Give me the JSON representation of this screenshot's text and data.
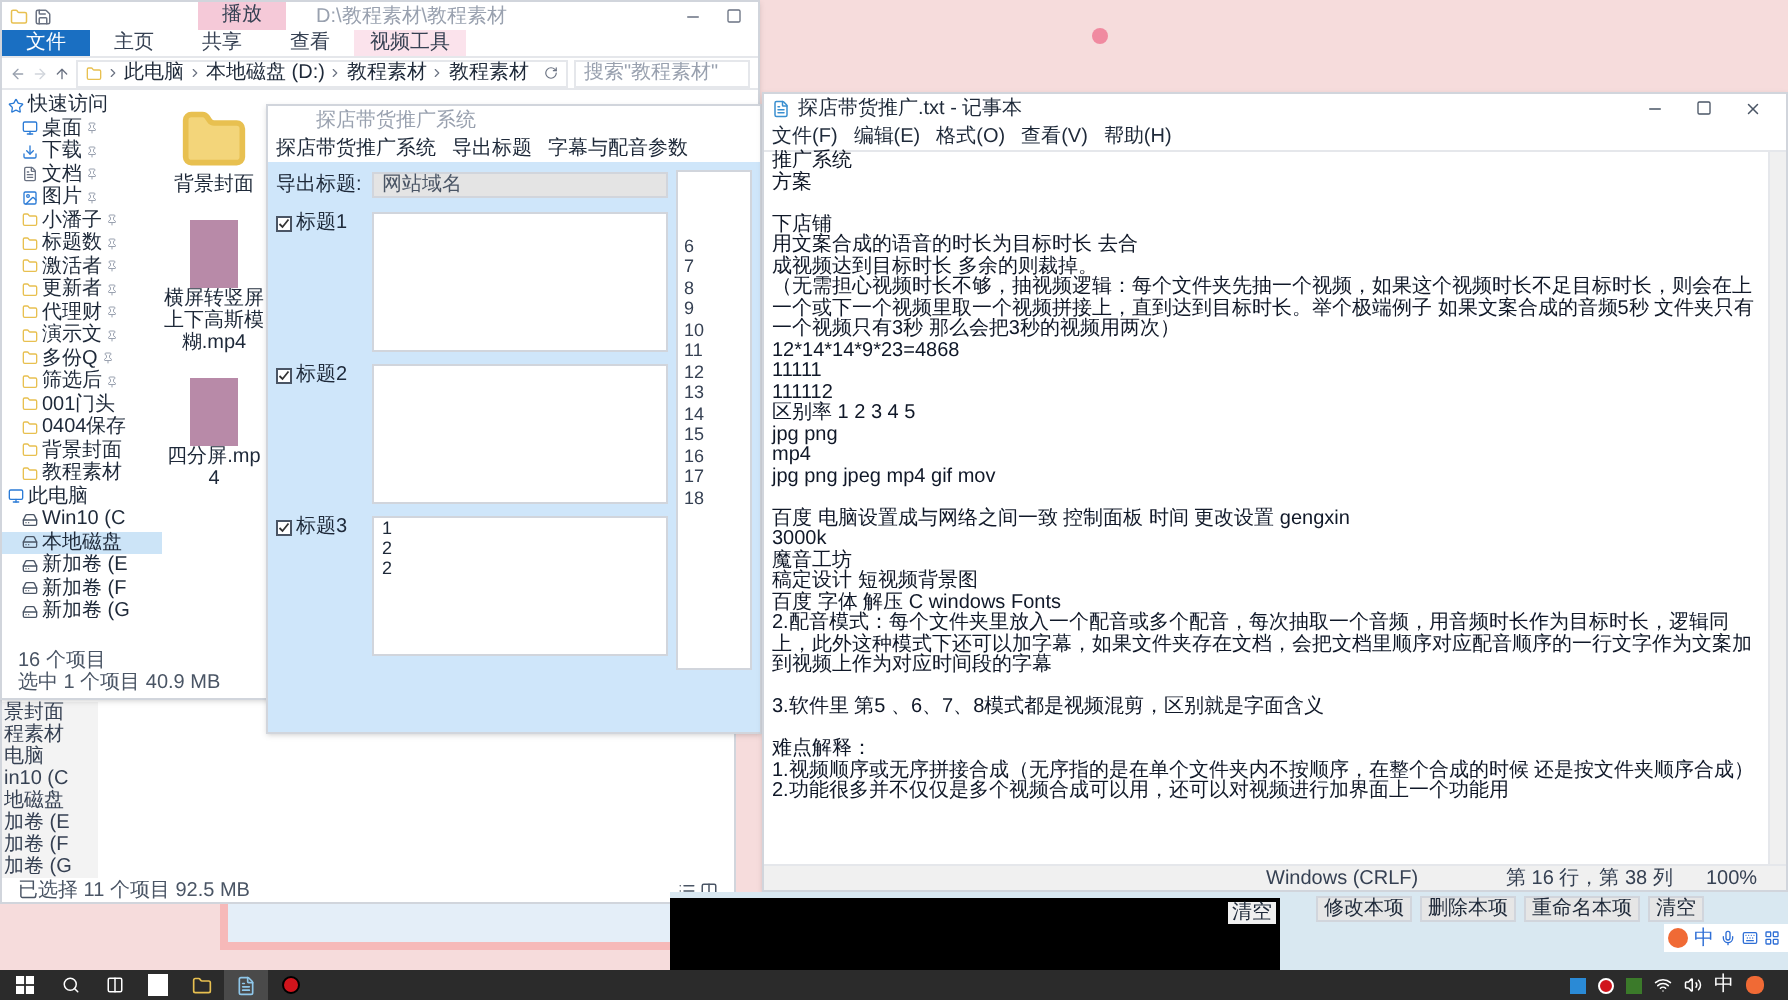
{
  "explorer_back": {
    "sidebar_items": [
      "景封面",
      "程素材",
      "电脑",
      "in10 (C",
      "地磁盘",
      "加卷 (E",
      "加卷 (F",
      "加卷 (G"
    ],
    "status": "已选择 11 个项目  92.5 MB"
  },
  "explorer": {
    "title": "D:\\教程素材\\教程素材",
    "context_tab": "播放",
    "ribbon_tabs": [
      {
        "label": "文件",
        "kind": "file"
      },
      {
        "label": "主页",
        "kind": "tab"
      },
      {
        "label": "共享",
        "kind": "tab"
      },
      {
        "label": "查看",
        "kind": "tab"
      },
      {
        "label": "视频工具",
        "kind": "context"
      }
    ],
    "breadcrumbs": [
      "此电脑",
      "本地磁盘 (D:)",
      "教程素材",
      "教程素材"
    ],
    "search": {
      "placeholder": "搜索\"教程素材\""
    },
    "sidebar": [
      {
        "label": "快速访问",
        "kind": "star",
        "pinned": false,
        "selected": false
      },
      {
        "label": "桌面",
        "kind": "desktop",
        "pinned": true,
        "selected": false
      },
      {
        "label": "下载",
        "kind": "download",
        "pinned": true,
        "selected": false
      },
      {
        "label": "文档",
        "kind": "document",
        "pinned": true,
        "selected": false
      },
      {
        "label": "图片",
        "kind": "picture",
        "pinned": true,
        "selected": false
      },
      {
        "label": "小潘子",
        "kind": "folder",
        "pinned": true,
        "selected": false
      },
      {
        "label": "标题数",
        "kind": "folder",
        "pinned": true,
        "selected": false
      },
      {
        "label": "激活者",
        "kind": "folder",
        "pinned": true,
        "selected": false
      },
      {
        "label": "更新者",
        "kind": "folder",
        "pinned": true,
        "selected": false
      },
      {
        "label": "代理财",
        "kind": "folder",
        "pinned": true,
        "selected": false
      },
      {
        "label": "演示文",
        "kind": "folder",
        "pinned": true,
        "selected": false
      },
      {
        "label": "多份Q",
        "kind": "folder",
        "pinned": true,
        "selected": false
      },
      {
        "label": "筛选后",
        "kind": "folder",
        "pinned": true,
        "selected": false
      },
      {
        "label": "001门头",
        "kind": "folder",
        "pinned": false,
        "selected": false
      },
      {
        "label": "0404保存",
        "kind": "folder",
        "pinned": false,
        "selected": false
      },
      {
        "label": "背景封面",
        "kind": "folder",
        "pinned": false,
        "selected": false
      },
      {
        "label": "教程素材",
        "kind": "folder",
        "pinned": false,
        "selected": false
      },
      {
        "label": "此电脑",
        "kind": "pc",
        "pinned": false,
        "selected": false
      },
      {
        "label": "Win10 (C",
        "kind": "drive",
        "pinned": false,
        "selected": false
      },
      {
        "label": "本地磁盘",
        "kind": "drive",
        "pinned": false,
        "selected": true
      },
      {
        "label": "新加卷 (E",
        "kind": "drive",
        "pinned": false,
        "selected": false
      },
      {
        "label": "新加卷 (F",
        "kind": "drive",
        "pinned": false,
        "selected": false
      },
      {
        "label": "新加卷 (G",
        "kind": "drive",
        "pinned": false,
        "selected": false
      }
    ],
    "files": [
      {
        "name": "背景封面",
        "kind": "folder"
      },
      {
        "name": "横屏转竖屏上下高斯模糊.mp4",
        "kind": "video"
      },
      {
        "name": "四分屏.mp4",
        "kind": "video"
      }
    ],
    "status": [
      "16 个项目",
      "选中 1 个项目  40.9 MB"
    ]
  },
  "dialog": {
    "title": "探店带货推广系统",
    "menu": [
      "探店带货推广系统",
      "导出标题",
      "字幕与配音参数"
    ],
    "export_label": "导出标题:",
    "export_value": "网站域名",
    "titles": [
      {
        "label": "标题1",
        "checked": true
      },
      {
        "label": "标题2",
        "checked": true
      },
      {
        "label": "标题3",
        "checked": true,
        "lines": [
          "1",
          "2",
          "2"
        ]
      }
    ],
    "line_numbers": [
      "6",
      "7",
      "8",
      "9",
      "10",
      "11",
      "12",
      "13",
      "14",
      "15",
      "16",
      "17",
      "18"
    ]
  },
  "notepad": {
    "title": "探店带货推广.txt - 记事本",
    "menu": [
      "文件(F)",
      "编辑(E)",
      "格式(O)",
      "查看(V)",
      "帮助(H)"
    ],
    "lines": [
      {
        "text": "推广系统",
        "space_before": false
      },
      {
        "text": "方案",
        "space_before": false
      },
      {
        "text": "下店铺",
        "space_before": true
      },
      {
        "text": "用文案合成的语音的时长为目标时长 去合",
        "space_before": false
      },
      {
        "text": "成视频达到目标时长 多余的则裁掉。",
        "space_before": false
      },
      {
        "text": "（无需担心视频时长不够，抽视频逻辑：每个文件夹先抽一个视频，如果这个视频时长不足目标时长，则会在上一个或下一个视频里取一个视频拼接上，直到达到目标时长。举个极端例子 如果文案合成的音频5秒 文件夹只有一个视频只有3秒 那么会把3秒的视频用两次）",
        "space_before": false
      },
      {
        "text": "12*14*14*9*23=4868",
        "space_before": false
      },
      {
        "text": "11111",
        "space_before": false
      },
      {
        "text": "111112",
        "space_before": false
      },
      {
        "text": "区别率  1 2 3 4 5",
        "space_before": false
      },
      {
        "text": "jpg png",
        "space_before": false
      },
      {
        "text": "mp4",
        "space_before": false
      },
      {
        "text": "jpg png jpeg mp4 gif mov",
        "space_before": false
      },
      {
        "text": "百度 电脑设置成与网络之间一致 控制面板 时间 更改设置 gengxin",
        "space_before": true
      },
      {
        "text": "3000k",
        "space_before": false
      },
      {
        "text": "魔音工坊",
        "space_before": false
      },
      {
        "text": "稿定设计  短视频背景图",
        "space_before": false
      },
      {
        "text": "百度 字体 解压 C windows Fonts",
        "space_before": false
      },
      {
        "text": "2.配音模式：每个文件夹里放入一个配音或多个配音，每次抽取一个音频，用音频时长作为目标时长，逻辑同上，此外这种模式下还可以加字幕，如果文件夹存在文档，会把文档里顺序对应配音顺序的一行文字作为文案加到视频上作为对应时间段的字幕",
        "space_before": false
      },
      {
        "text": "3.软件里 第5 、6、7、8模式都是视频混剪，区别就是字面含义",
        "space_before": true
      },
      {
        "text": "难点解释：",
        "space_before": true
      },
      {
        "text": "1.视频顺序或无序拼接合成（无序指的是在单个文件夹内不按顺序，在整个合成的时候 还是按文件夹顺序合成）",
        "space_before": false
      },
      {
        "text": "2.功能很多并不仅仅是多个视频合成可以用，还可以对视频进行加界面上一个功能用",
        "space_before": false
      }
    ],
    "status": [
      "Windows (CRLF)",
      "第 16 行，第 38 列",
      "100%"
    ]
  },
  "tool_panel": {
    "console_button": "清空",
    "buttons": [
      "修改本项",
      "删除本项",
      "重命名本项",
      "清空"
    ]
  },
  "ime": {
    "mode": "中"
  },
  "taskbar": {
    "ime_mode": "中"
  }
}
